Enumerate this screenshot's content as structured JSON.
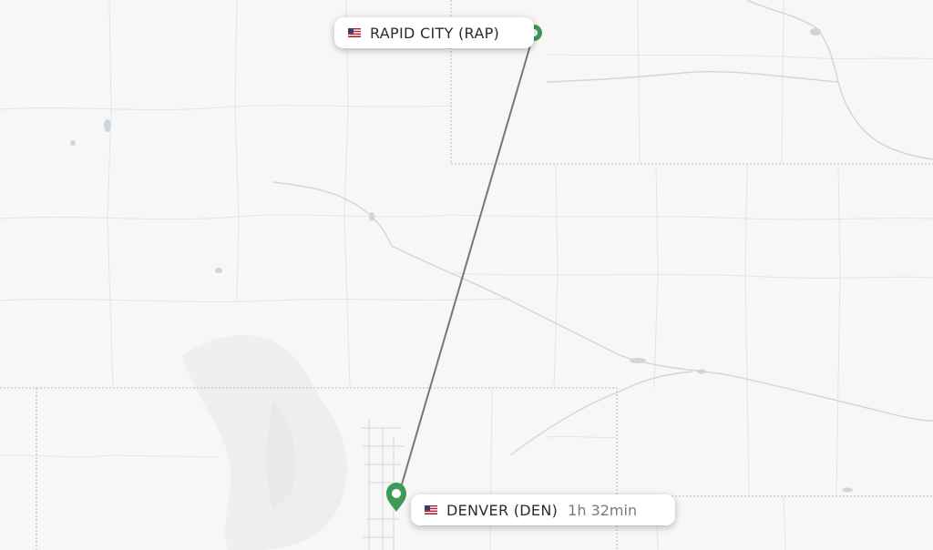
{
  "map": {
    "background_color": "#f7f7f7",
    "route_color": "#777777",
    "marker_color": "#3f9a5a",
    "marker_icon": "map-pin-icon",
    "flag_icon": "us-flag-icon"
  },
  "origin": {
    "name": "RAPID CITY (RAP)"
  },
  "destination": {
    "name": "DENVER (DEN)",
    "duration": "1h 32min"
  }
}
